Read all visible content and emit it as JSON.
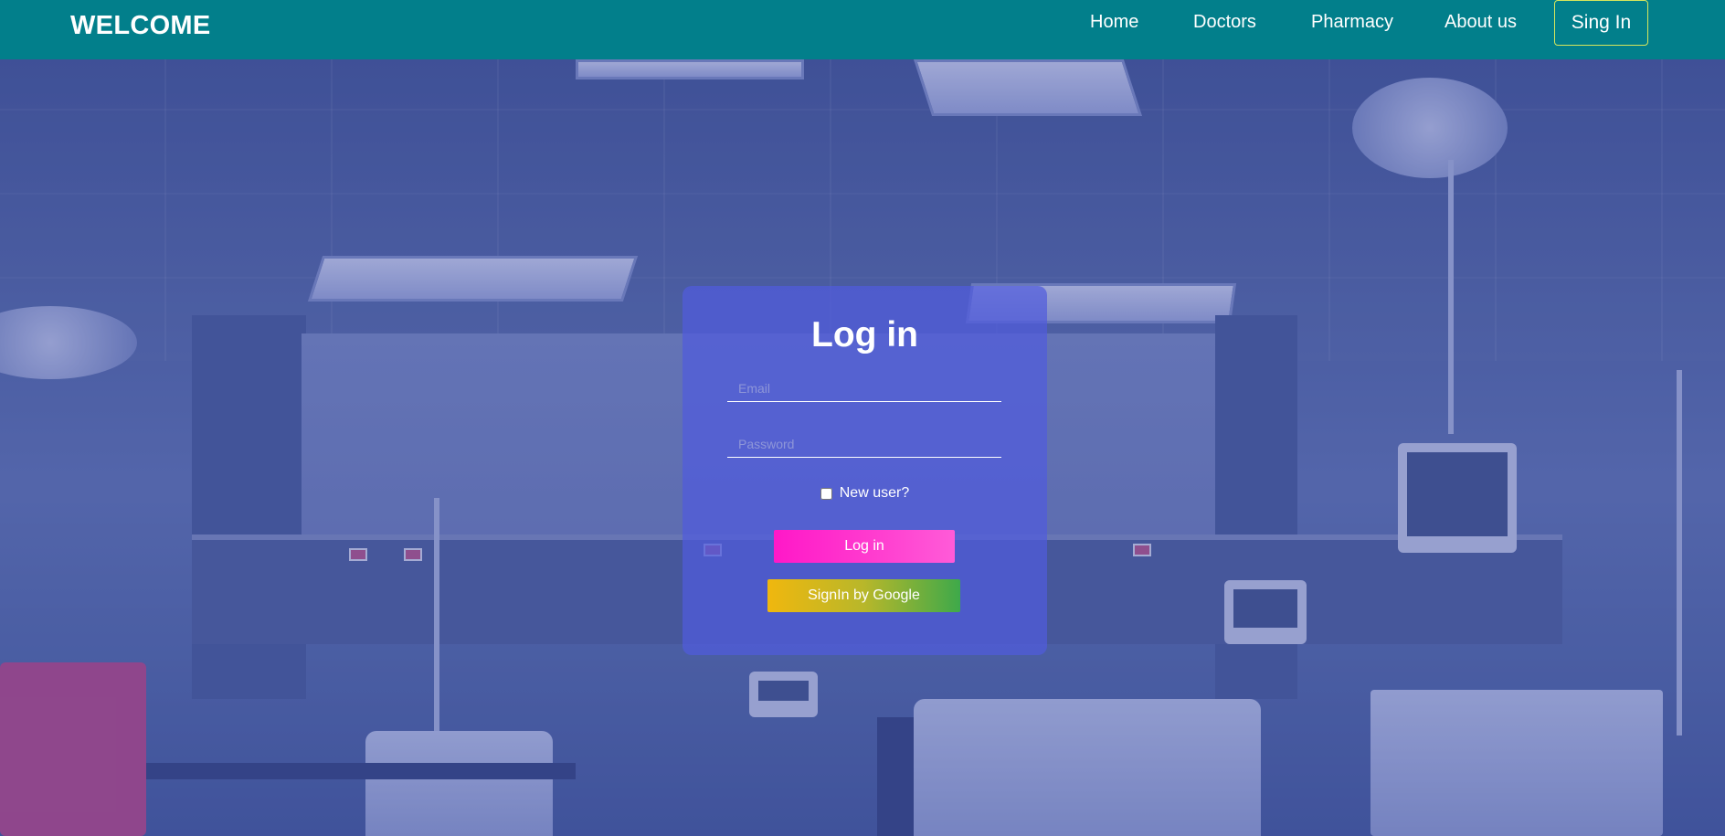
{
  "navbar": {
    "brand": "WELCOME",
    "links": [
      "Home",
      "Doctors",
      "Pharmacy",
      "About us"
    ],
    "signin_label": "Sing In"
  },
  "login": {
    "title": "Log in",
    "email_placeholder": "Email",
    "password_placeholder": "Password",
    "new_user_label": "New user?",
    "new_user_checked": false,
    "login_button": "Log in",
    "google_button": "SignIn by Google"
  },
  "colors": {
    "navbar": "#027f8b",
    "card": "#505cdc",
    "login_button": "#ff18c8",
    "google_gradient_start": "#f0b70e",
    "google_gradient_end": "#3ea94a",
    "signin_border": "#d7e65c"
  },
  "background": {
    "subject": "hospital-room-photo"
  }
}
